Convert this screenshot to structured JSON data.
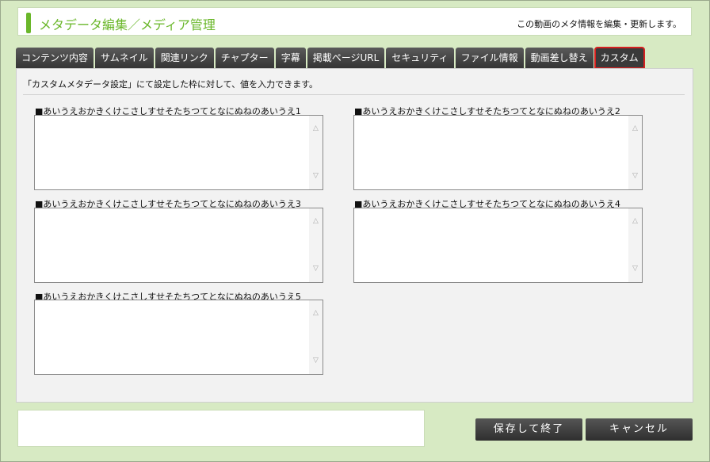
{
  "header": {
    "title": "メタデータ編集／メディア管理",
    "description": "この動画のメタ情報を編集・更新します。"
  },
  "tabs": [
    {
      "label": "コンテンツ内容",
      "active": false
    },
    {
      "label": "サムネイル",
      "active": false
    },
    {
      "label": "関連リンク",
      "active": false
    },
    {
      "label": "チャプター",
      "active": false
    },
    {
      "label": "字幕",
      "active": false
    },
    {
      "label": "掲載ページURL",
      "active": false
    },
    {
      "label": "セキュリティ",
      "active": false
    },
    {
      "label": "ファイル情報",
      "active": false
    },
    {
      "label": "動画差し替え",
      "active": false
    },
    {
      "label": "カスタム",
      "active": true
    }
  ],
  "panel": {
    "instruction": "「カスタムメタデータ設定」にて設定した枠に対して、値を入力できます。",
    "fields": [
      {
        "label": "■あいうえおかきくけこさしすせそたちつてとなにぬねのあいうえ1",
        "value": ""
      },
      {
        "label": "■あいうえおかきくけこさしすせそたちつてとなにぬねのあいうえ2",
        "value": ""
      },
      {
        "label": "■あいうえおかきくけこさしすせそたちつてとなにぬねのあいうえ3",
        "value": ""
      },
      {
        "label": "■あいうえおかきくけこさしすせそたちつてとなにぬねのあいうえ4",
        "value": ""
      },
      {
        "label": "■あいうえおかきくけこさしすせそたちつてとなにぬねのあいうえ5",
        "value": ""
      }
    ]
  },
  "actions": {
    "save_label": "保存して終了",
    "cancel_label": "キャンセル"
  },
  "colors": {
    "background": "#d7eac3",
    "accent": "#6ab72a",
    "tab": "#3f3f3f",
    "active_outline": "#d52020"
  }
}
